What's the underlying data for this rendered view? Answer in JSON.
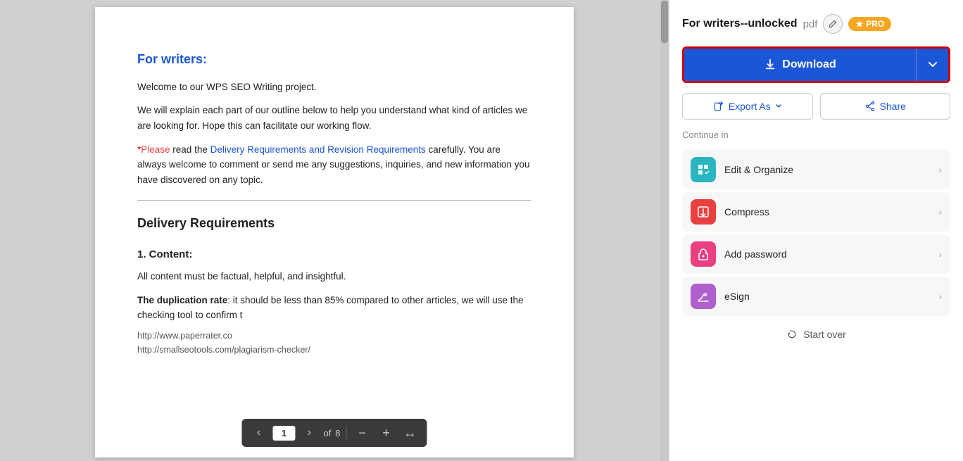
{
  "header": {
    "filename": "For writers--unlocked",
    "fileext": " pdf",
    "pro_label": "★PRO"
  },
  "download": {
    "main_label": "Download",
    "chevron": "▾"
  },
  "actions": {
    "export_label": "Export As",
    "share_label": "Share"
  },
  "continue": {
    "section_label": "Continue in",
    "items": [
      {
        "id": "edit",
        "label": "Edit & Organize",
        "icon": "✏️",
        "icon_class": "icon-edit",
        "icon_char": "✎"
      },
      {
        "id": "compress",
        "label": "Compress",
        "icon_class": "icon-compress",
        "icon_char": "⊞"
      },
      {
        "id": "password",
        "label": "Add password",
        "icon_class": "icon-password",
        "icon_char": "🔒"
      },
      {
        "id": "esign",
        "label": "eSign",
        "icon_class": "icon-esign",
        "icon_char": "✍"
      }
    ]
  },
  "start_over": {
    "label": "Start over"
  },
  "pdf": {
    "for_writers_title": "For writers:",
    "intro1": "Welcome to our WPS SEO Writing project.",
    "intro2": "We will explain each part of our outline below to help you understand what kind of articles we are looking for. Hope this can facilitate our working flow.",
    "notice": "*Please read the Delivery Requirements and Revision Requirements carefully. You are always welcome to comment or send me any suggestions, inquiries, and new information you have discovered on any topic.",
    "delivery_title": "Delivery Requirements",
    "content_title": "1. Content:",
    "content_desc": "All content must be factual, helpful, and insightful.",
    "dup_rate_label": "The duplication rate",
    "dup_rate_text": ": it should be less than 85% compared to other articles, we will use the checking tool to confirm t",
    "url1": "http://www.paperrater.co",
    "url2": "http://smallseotools.com/plagiarism-checker/",
    "page_current": "1",
    "page_total": "8"
  },
  "colors": {
    "blue": "#1a56d6",
    "red_border": "#cc0000",
    "pro_orange": "#f5a623"
  }
}
